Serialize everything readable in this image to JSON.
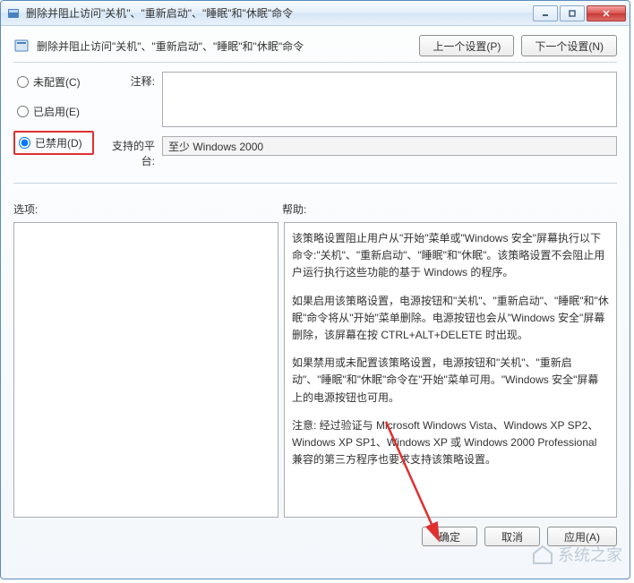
{
  "window": {
    "title": "删除并阻止访问\"关机\"、\"重新启动\"、\"睡眠\"和\"休眠\"命令"
  },
  "header": {
    "title": "删除并阻止访问\"关机\"、\"重新启动\"、\"睡眠\"和\"休眠\"命令",
    "prev": "上一个设置(P)",
    "next": "下一个设置(N)"
  },
  "radios": {
    "not_configured": "未配置(C)",
    "enabled": "已启用(E)",
    "disabled": "已禁用(D)",
    "selected": "disabled"
  },
  "fields": {
    "comment_label": "注释:",
    "comment_value": "",
    "platform_label": "支持的平台:",
    "platform_value": "至少 Windows 2000"
  },
  "sections": {
    "options_label": "选项:",
    "help_label": "帮助:"
  },
  "help": {
    "p1": "该策略设置阻止用户从\"开始\"菜单或\"Windows 安全\"屏幕执行以下命令:\"关机\"、\"重新启动\"、\"睡眠\"和\"休眠\"。该策略设置不会阻止用户运行执行这些功能的基于 Windows 的程序。",
    "p2": "如果启用该策略设置，电源按钮和\"关机\"、\"重新启动\"、\"睡眠\"和\"休眠\"命令将从\"开始\"菜单删除。电源按钮也会从\"Windows 安全\"屏幕删除，该屏幕在按 CTRL+ALT+DELETE 时出现。",
    "p3": "如果禁用或未配置该策略设置，电源按钮和\"关机\"、\"重新启动\"、\"睡眠\"和\"休眠\"命令在\"开始\"菜单可用。\"Windows 安全\"屏幕上的电源按钮也可用。",
    "p4": "注意: 经过验证与 Microsoft Windows Vista、Windows XP SP2、Windows XP SP1、Windows XP 或 Windows 2000 Professional 兼容的第三方程序也要求支持该策略设置。"
  },
  "buttons": {
    "ok": "确定",
    "cancel": "取消",
    "apply": "应用(A)"
  },
  "watermark": "系统之家"
}
